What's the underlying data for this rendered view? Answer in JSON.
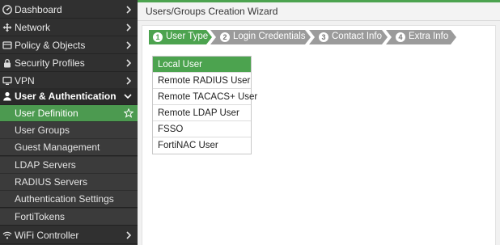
{
  "colors": {
    "accent": "#4ca34f",
    "sidebar_bg": "#303030",
    "sidebar_sub_bg": "#3b3b3b",
    "step_inactive": "#9b9b9b"
  },
  "sidebar": {
    "items": [
      {
        "label": "Dashboard",
        "icon": "dashboard-icon"
      },
      {
        "label": "Network",
        "icon": "network-icon"
      },
      {
        "label": "Policy & Objects",
        "icon": "policy-icon"
      },
      {
        "label": "Security Profiles",
        "icon": "lock-icon"
      },
      {
        "label": "VPN",
        "icon": "monitor-icon"
      },
      {
        "label": "User & Authentication",
        "icon": "user-icon"
      }
    ],
    "sub_items": [
      {
        "label": "User Definition"
      },
      {
        "label": "User Groups"
      },
      {
        "label": "Guest Management"
      },
      {
        "label": "LDAP Servers"
      },
      {
        "label": "RADIUS Servers"
      },
      {
        "label": "Authentication Settings"
      },
      {
        "label": "FortiTokens"
      }
    ],
    "bottom_item": {
      "label": "WiFi Controller",
      "icon": "wifi-icon"
    }
  },
  "header": {
    "title": "Users/Groups Creation Wizard"
  },
  "wizard": {
    "steps": [
      {
        "num": "1",
        "label": "User Type"
      },
      {
        "num": "2",
        "label": "Login Credentials"
      },
      {
        "num": "3",
        "label": "Contact Info"
      },
      {
        "num": "4",
        "label": "Extra Info"
      }
    ]
  },
  "user_types": [
    {
      "label": "Local User"
    },
    {
      "label": "Remote RADIUS User"
    },
    {
      "label": "Remote TACACS+ User"
    },
    {
      "label": "Remote LDAP User"
    },
    {
      "label": "FSSO"
    },
    {
      "label": "FortiNAC User"
    }
  ]
}
